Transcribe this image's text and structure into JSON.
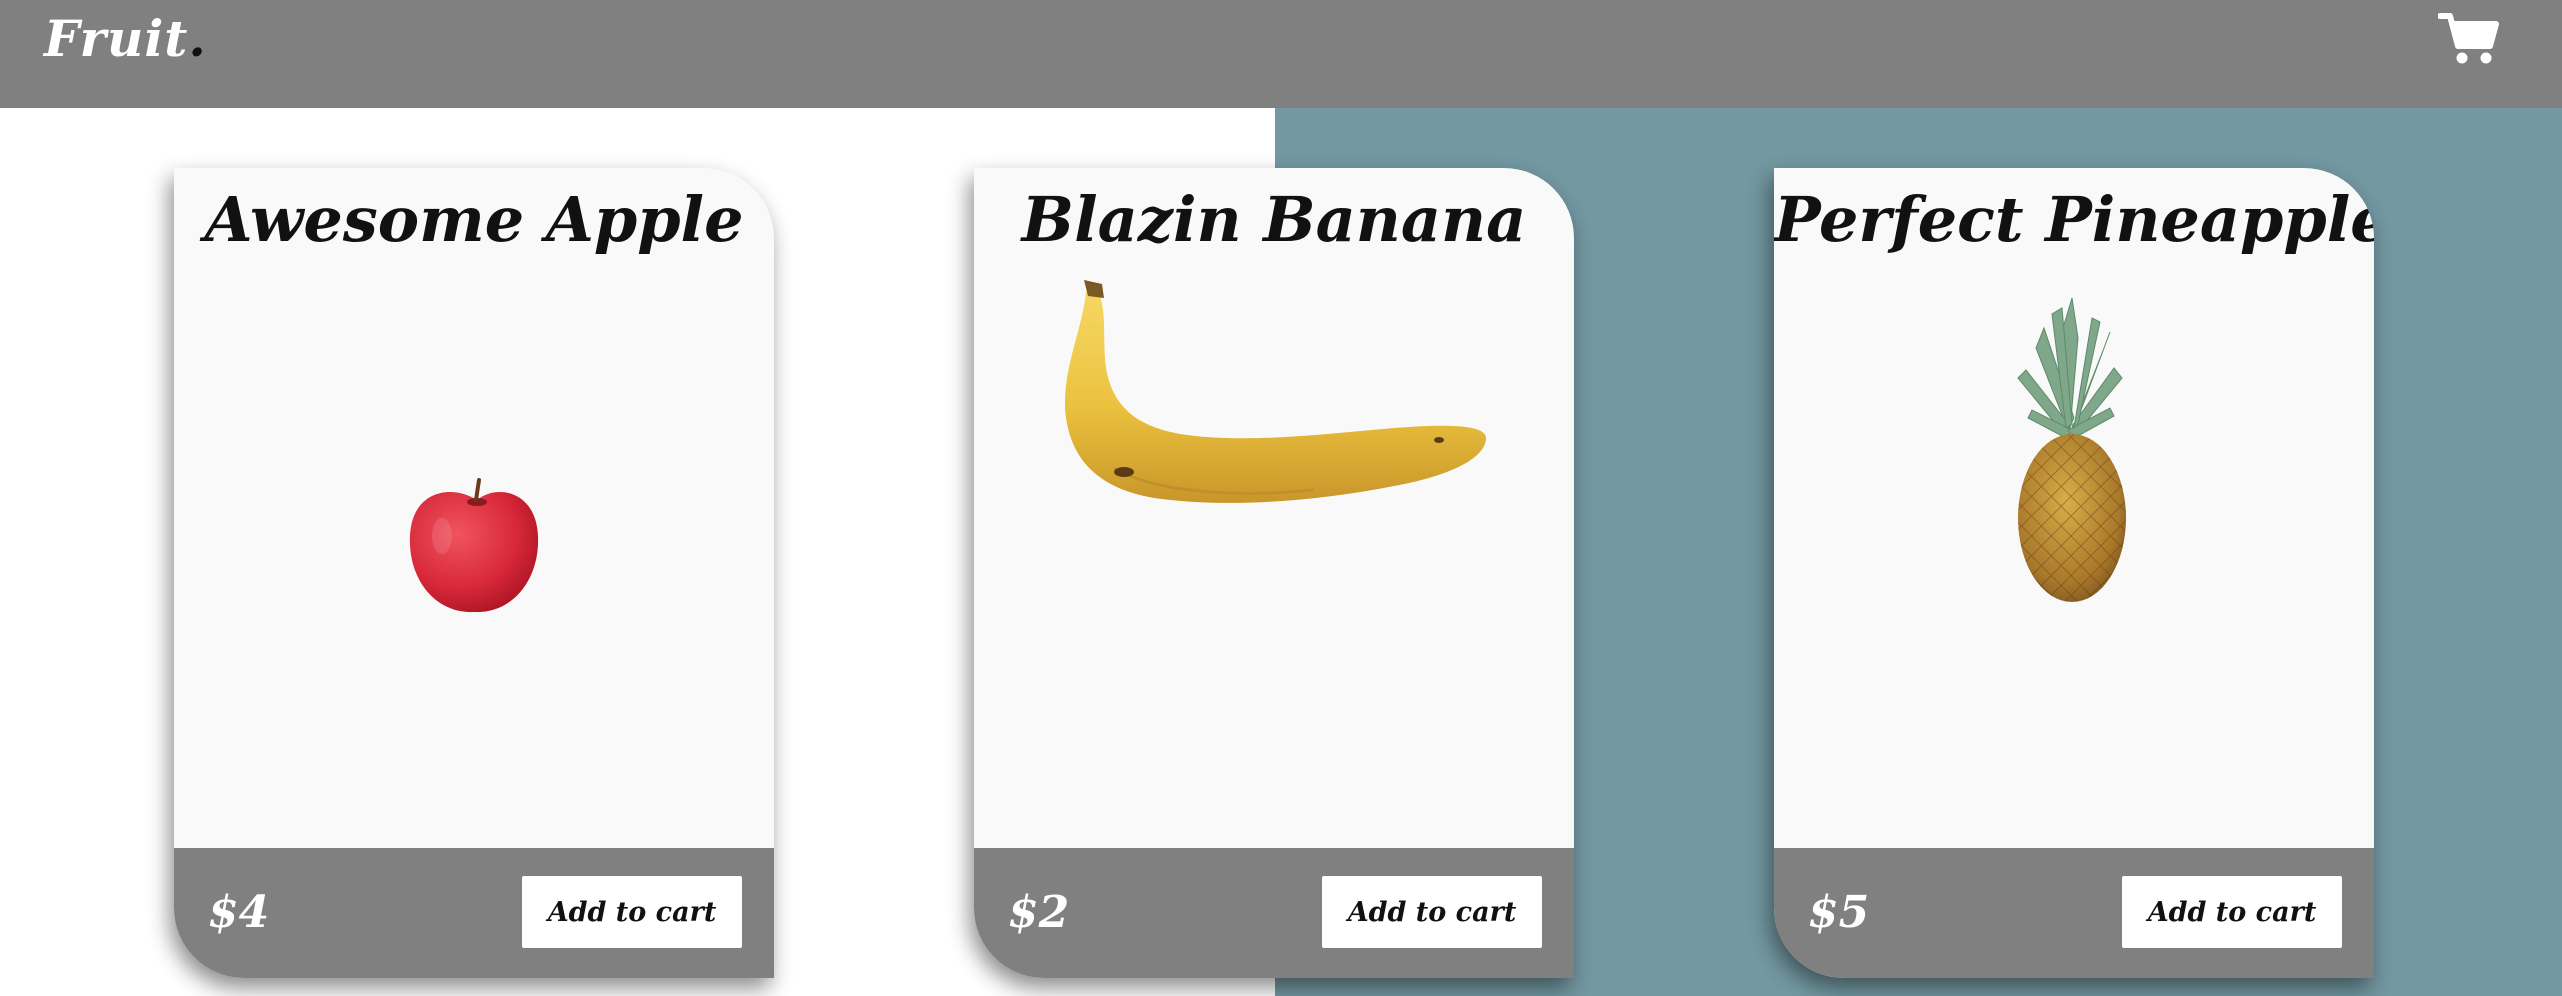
{
  "header": {
    "logo_text": "Fruit",
    "logo_dot": ".",
    "cart_icon": "shopping-cart-icon"
  },
  "colors": {
    "header_bg": "#808080",
    "accent_bg": "#7398a2",
    "card_bg": "#f9f9f9",
    "footer_bg": "#808080"
  },
  "products": [
    {
      "title": "Awesome Apple",
      "price": "$4",
      "button_label": "Add to cart",
      "image_icon": "apple-image"
    },
    {
      "title": "Blazin Banana",
      "price": "$2",
      "button_label": "Add to cart",
      "image_icon": "banana-image"
    },
    {
      "title": "Perfect Pineapple",
      "price": "$5",
      "button_label": "Add to cart",
      "image_icon": "pineapple-image"
    }
  ]
}
